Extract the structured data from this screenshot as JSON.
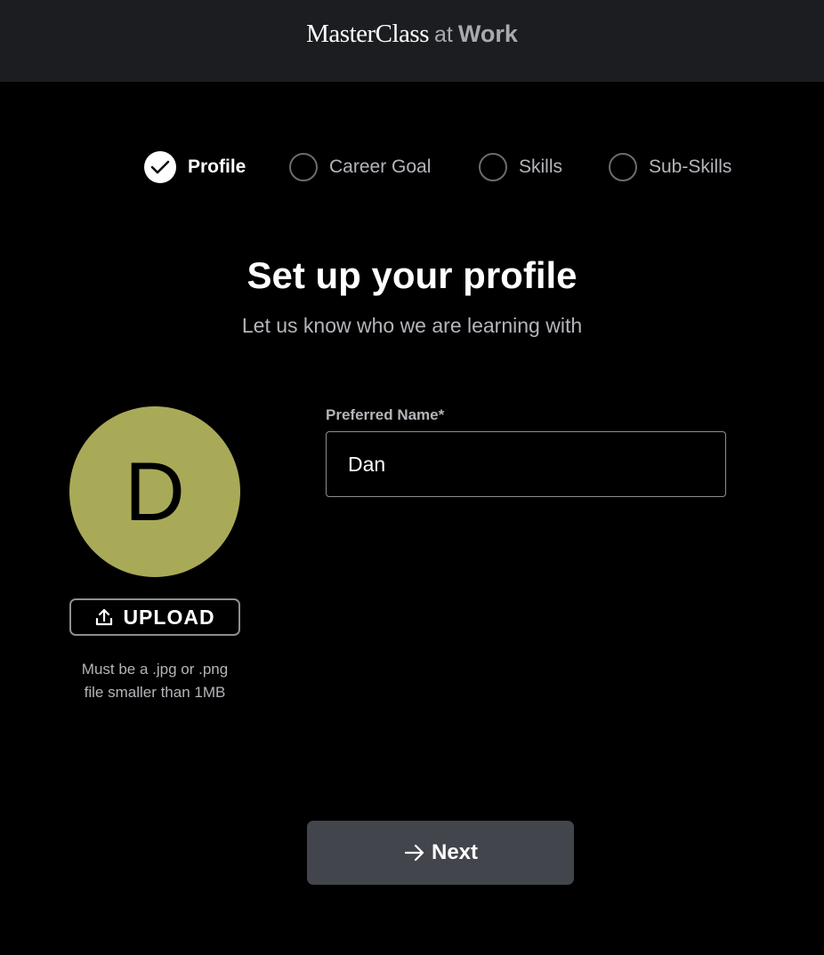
{
  "header": {
    "brand": "MasterClass",
    "at": "at",
    "work": "Work"
  },
  "steps": [
    {
      "label": "Profile",
      "state": "completed",
      "icon": "check-icon"
    },
    {
      "label": "Career Goal",
      "state": "pending"
    },
    {
      "label": "Skills",
      "state": "pending"
    },
    {
      "label": "Sub-Skills",
      "state": "pending"
    }
  ],
  "main": {
    "title": "Set up your profile",
    "subtitle": "Let us know who we are learning with"
  },
  "avatar": {
    "initial": "D",
    "color": "#a9aa58",
    "upload_label": "UPLOAD",
    "upload_icon": "upload-icon",
    "hint_line1": "Must be a .jpg or .png",
    "hint_line2": "file smaller than 1MB"
  },
  "form": {
    "name_label": "Preferred Name*",
    "name_value": "Dan"
  },
  "footer": {
    "next_label": "Next",
    "next_icon": "arrow-right-icon"
  },
  "colors": {
    "background": "#000000",
    "header": "#1c1d20",
    "button": "#43454d"
  }
}
